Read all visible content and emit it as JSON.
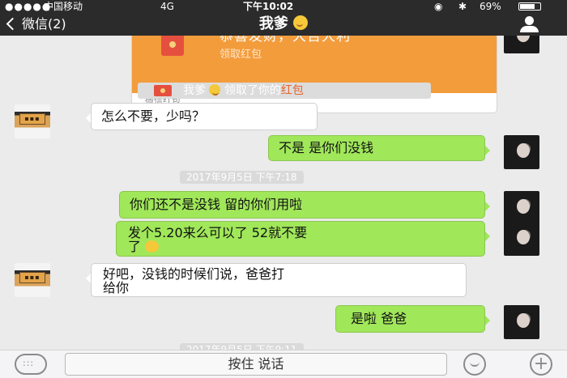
{
  "status_bar": {
    "carrier": "中国移动",
    "network": "4G",
    "time": "下午10:02",
    "battery": "69%"
  },
  "nav": {
    "back": "微信(2)",
    "title": "我爹"
  },
  "red_packet": {
    "title": "恭喜发财，大吉大利",
    "action": "领取红包",
    "footer": "微信红包"
  },
  "system_notice": {
    "name": "我爹",
    "middle": "领取了你的",
    "highlight": "红包"
  },
  "messages": {
    "m1": "怎么不要，少吗？",
    "m2": "不是 是你们没钱",
    "ts1": "2017年9月5日 下午7:18",
    "m3": "你们还不是没钱 留的你们用啦",
    "m4_line1": "发个5.20来么可以了 52就不要",
    "m4_line2": "了",
    "m5_line1": "好吧，没钱的时候们说，爸爸打",
    "m5_line2": "给你",
    "m6": "是啦 爸爸",
    "ts2": "2017年9月5日 下午9:11"
  },
  "input_bar": {
    "hold_to_talk": "按住 说话"
  },
  "colors": {
    "header": "#2b2b2b",
    "chat_bg": "#ebebeb",
    "bubble_green": "#a0e75a",
    "red_packet": "#f39c3c",
    "highlight_red": "#e6632d"
  }
}
